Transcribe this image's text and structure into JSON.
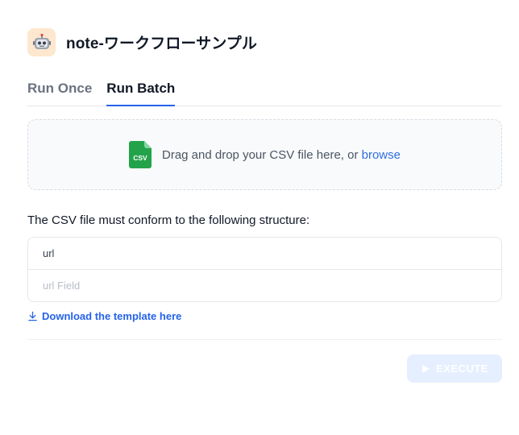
{
  "app": {
    "title": "note-ワークフローサンプル",
    "icon": "robot-icon"
  },
  "tabs": [
    {
      "label": "Run Once",
      "active": false
    },
    {
      "label": "Run Batch",
      "active": true
    }
  ],
  "upload": {
    "icon": "csv-file-icon",
    "icon_label": "CSV",
    "text": "Drag and drop your CSV file here, or ",
    "browse_label": "browse"
  },
  "structure": {
    "label": "The CSV file must conform to the following structure:",
    "header": "url",
    "placeholder": "url Field"
  },
  "download": {
    "icon": "download-icon",
    "label": "Download the template here"
  },
  "execute": {
    "icon": "play-icon",
    "label": "EXECUTE",
    "enabled": false
  },
  "colors": {
    "accent": "#2563eb",
    "csv_icon": "#22a34a",
    "app_icon_bg": "#fde7cf",
    "execute_disabled_bg": "#e6efff"
  }
}
